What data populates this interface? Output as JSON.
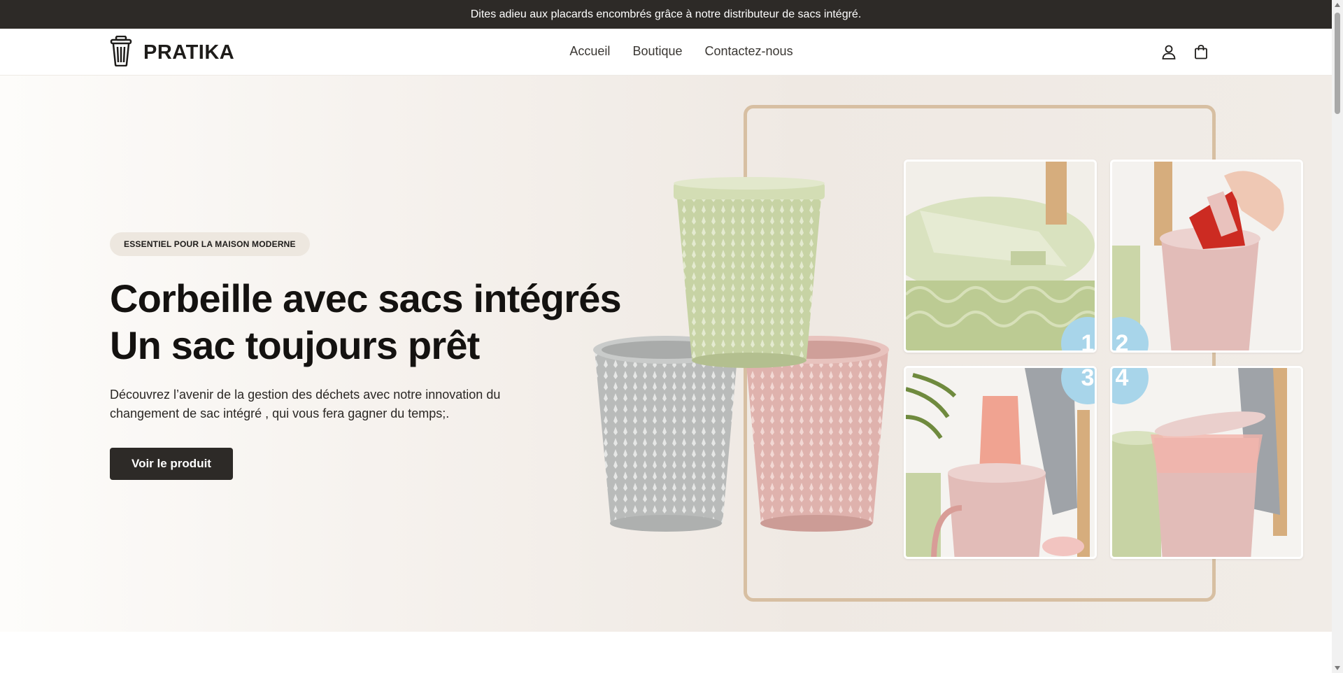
{
  "announcement": {
    "text": "Dites adieu aux placards encombrés grâce à notre distributeur de sacs intégré."
  },
  "header": {
    "logo_text": "PRATIKA",
    "logo_icon": "trash-bin-icon",
    "nav": [
      {
        "label": "Accueil"
      },
      {
        "label": "Boutique"
      },
      {
        "label": "Contactez-nous"
      }
    ],
    "icons": [
      "user-icon",
      "shopping-bag-icon"
    ]
  },
  "hero": {
    "badge": "ESSENTIEL POUR LA MAISON MODERNE",
    "title_line1": "Corbeille avec sacs intégrés",
    "title_line2": "Un sac toujours prêt",
    "description": "Découvrez l’avenir de la gestion des déchets avec notre innovation du changement de sac intégré , qui vous fera gagner du temps;.",
    "cta_label": "Voir le produit",
    "steps": [
      "1",
      "2",
      "3",
      "4"
    ]
  },
  "colors": {
    "announcement_bg": "#2d2a27",
    "hero_bg": "#f1ece7",
    "frame": "#d7bfa2",
    "step_badge": "#a8d5ea",
    "bin_green": "#c7d3a4",
    "bin_grey": "#c2c4c3",
    "bin_pink": "#dfb2ad"
  }
}
